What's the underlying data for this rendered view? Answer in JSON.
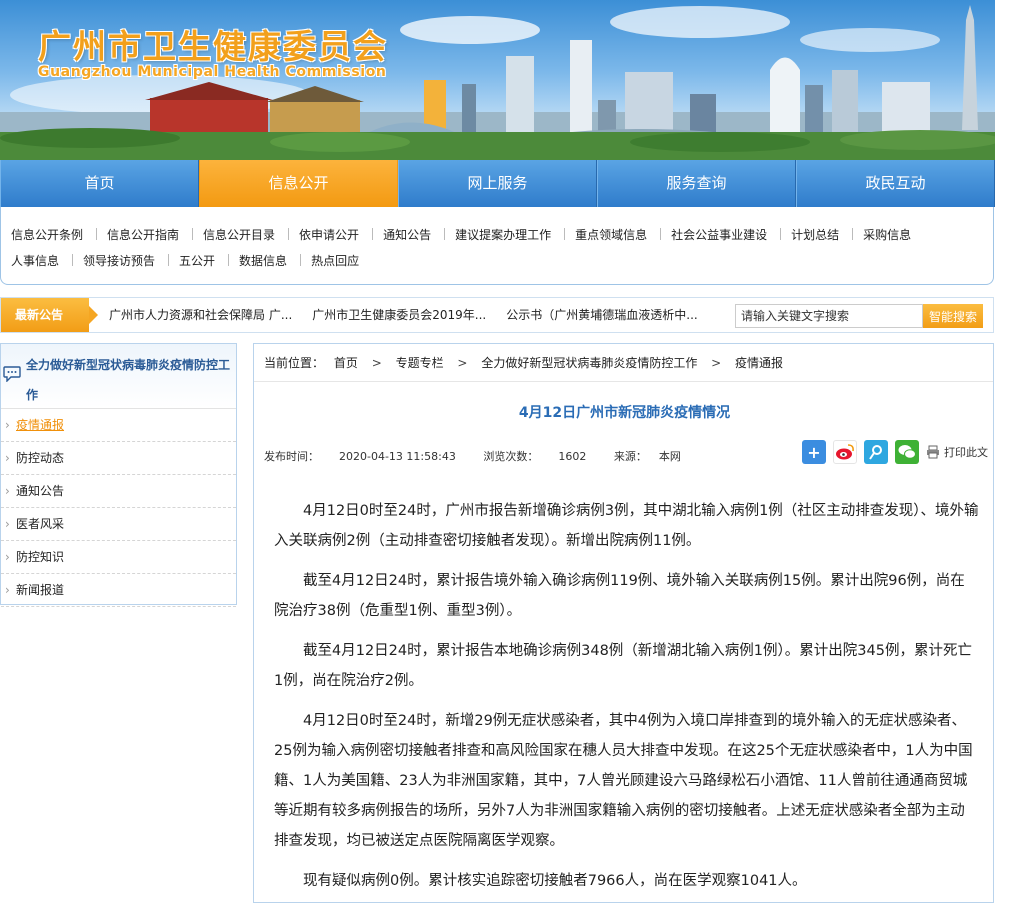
{
  "site": {
    "name_cn": "广州市卫生健康委员会",
    "name_en": "Guangzhou Municipal Health Commission"
  },
  "main_nav": [
    {
      "label": "首页",
      "active": false
    },
    {
      "label": "信息公开",
      "active": true
    },
    {
      "label": "网上服务",
      "active": false
    },
    {
      "label": "服务查询",
      "active": false
    },
    {
      "label": "政民互动",
      "active": false
    }
  ],
  "sub_nav": {
    "row1": [
      "信息公开条例",
      "信息公开指南",
      "信息公开目录",
      "依申请公开",
      "通知公告",
      "建议提案办理工作",
      "重点领域信息",
      "社会公益事业建设",
      "计划总结",
      "采购信息"
    ],
    "row2": [
      "人事信息",
      "领导接访预告",
      "五公开",
      "数据信息",
      "热点回应"
    ]
  },
  "notice": {
    "tag": "最新公告",
    "items": [
      "广州市人力资源和社会保障局 广...",
      "广州市卫生健康委员会2019年...",
      "公示书（广州黄埔德瑞血液透析中..."
    ]
  },
  "search": {
    "placeholder": "请输入关键文字搜索",
    "button": "智能搜索"
  },
  "sidebar": {
    "title": "全力做好新型冠状病毒肺炎疫情防控工作",
    "items": [
      {
        "label": "疫情通报",
        "active": true
      },
      {
        "label": "防控动态",
        "active": false
      },
      {
        "label": "通知公告",
        "active": false
      },
      {
        "label": "医者风采",
        "active": false
      },
      {
        "label": "防控知识",
        "active": false
      },
      {
        "label": "新闻报道",
        "active": false
      }
    ]
  },
  "breadcrumb": {
    "prefix": "当前位置：",
    "items": [
      "首页",
      "专题专栏",
      "全力做好新型冠状病毒肺炎疫情防控工作",
      "疫情通报"
    ]
  },
  "article": {
    "title": "4月12日广州市新冠肺炎疫情情况",
    "publish_label": "发布时间：",
    "publish_time": "2020-04-13 11:58:43",
    "views_label": "浏览次数：",
    "views": "1602",
    "source_label": "来源：",
    "source": "本网",
    "print_label": "打印此文",
    "paragraphs": [
      "4月12日0时至24时，广州市报告新增确诊病例3例，其中湖北输入病例1例（社区主动排查发现）、境外输入关联病例2例（主动排查密切接触者发现）。新增出院病例11例。",
      "截至4月12日24时，累计报告境外输入确诊病例119例、境外输入关联病例15例。累计出院96例，尚在院治疗38例（危重型1例、重型3例）。",
      "截至4月12日24时，累计报告本地确诊病例348例（新增湖北输入病例1例）。累计出院345例，累计死亡1例，尚在院治疗2例。",
      "4月12日0时至24时，新增29例无症状感染者，其中4例为入境口岸排查到的境外输入的无症状感染者、25例为输入病例密切接触者排查和高风险国家在穗人员大排查中发现。在这25个无症状感染者中，1人为中国籍、1人为美国籍、23人为非洲国家籍，其中，7人曾光顾建设六马路绿松石小酒馆、11人曾前往通通商贸城等近期有较多病例报告的场所，另外7人为非洲国家籍输入病例的密切接触者。上述无症状感染者全部为主动排查发现，均已被送定点医院隔离医学观察。",
      "现有疑似病例0例。累计核实追踪密切接触者7966人，尚在医学观察1041人。"
    ]
  },
  "colors": {
    "nav_blue": "#2f7ccb",
    "nav_active": "#f5a623",
    "title_blue": "#2a6cb5"
  }
}
